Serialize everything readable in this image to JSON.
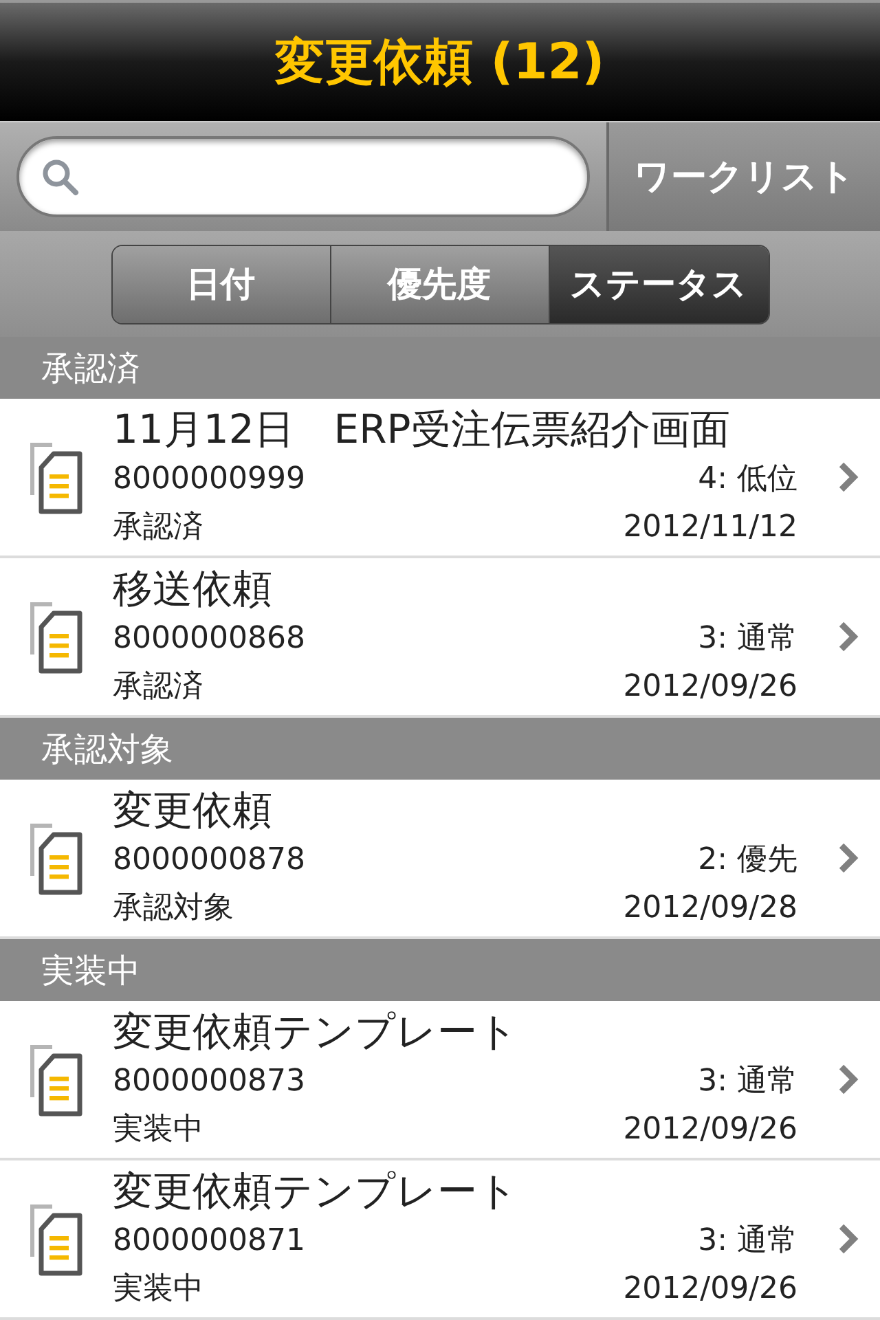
{
  "nav": {
    "title": "変更依頼 (12)"
  },
  "search": {
    "button": "ワークリスト"
  },
  "sort_tabs": [
    {
      "label": "日付",
      "selected": false
    },
    {
      "label": "優先度",
      "selected": false
    },
    {
      "label": "ステータス",
      "selected": true
    }
  ],
  "sections": [
    {
      "label": "承認済",
      "items": [
        {
          "title": "11月12日　ERP受注伝票紹介画面",
          "number": "8000000999",
          "priority": "4: 低位",
          "status": "承認済",
          "date": "2012/11/12"
        },
        {
          "title": "移送依頼",
          "number": "8000000868",
          "priority": "3: 通常",
          "status": "承認済",
          "date": "2012/09/26"
        }
      ]
    },
    {
      "label": "承認対象",
      "items": [
        {
          "title": "変更依頼",
          "number": "8000000878",
          "priority": "2: 優先",
          "status": "承認対象",
          "date": "2012/09/28"
        }
      ]
    },
    {
      "label": "実装中",
      "items": [
        {
          "title": "変更依頼テンプレート",
          "number": "8000000873",
          "priority": "3: 通常",
          "status": "実装中",
          "date": "2012/09/26"
        },
        {
          "title": "変更依頼テンプレート",
          "number": "8000000871",
          "priority": "3: 通常",
          "status": "実装中",
          "date": "2012/09/26"
        }
      ]
    }
  ]
}
